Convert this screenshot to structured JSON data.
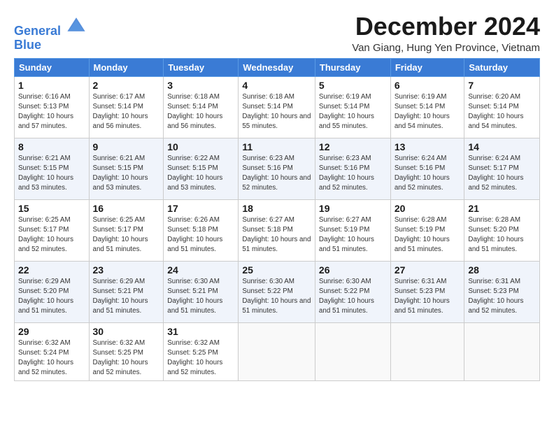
{
  "header": {
    "logo_line1": "General",
    "logo_line2": "Blue",
    "month_title": "December 2024",
    "subtitle": "Van Giang, Hung Yen Province, Vietnam"
  },
  "weekdays": [
    "Sunday",
    "Monday",
    "Tuesday",
    "Wednesday",
    "Thursday",
    "Friday",
    "Saturday"
  ],
  "weeks": [
    [
      {
        "day": 1,
        "sunrise": "6:16 AM",
        "sunset": "5:13 PM",
        "daylight": "10 hours and 57 minutes."
      },
      {
        "day": 2,
        "sunrise": "6:17 AM",
        "sunset": "5:14 PM",
        "daylight": "10 hours and 56 minutes."
      },
      {
        "day": 3,
        "sunrise": "6:18 AM",
        "sunset": "5:14 PM",
        "daylight": "10 hours and 56 minutes."
      },
      {
        "day": 4,
        "sunrise": "6:18 AM",
        "sunset": "5:14 PM",
        "daylight": "10 hours and 55 minutes."
      },
      {
        "day": 5,
        "sunrise": "6:19 AM",
        "sunset": "5:14 PM",
        "daylight": "10 hours and 55 minutes."
      },
      {
        "day": 6,
        "sunrise": "6:19 AM",
        "sunset": "5:14 PM",
        "daylight": "10 hours and 54 minutes."
      },
      {
        "day": 7,
        "sunrise": "6:20 AM",
        "sunset": "5:14 PM",
        "daylight": "10 hours and 54 minutes."
      }
    ],
    [
      {
        "day": 8,
        "sunrise": "6:21 AM",
        "sunset": "5:15 PM",
        "daylight": "10 hours and 53 minutes."
      },
      {
        "day": 9,
        "sunrise": "6:21 AM",
        "sunset": "5:15 PM",
        "daylight": "10 hours and 53 minutes."
      },
      {
        "day": 10,
        "sunrise": "6:22 AM",
        "sunset": "5:15 PM",
        "daylight": "10 hours and 53 minutes."
      },
      {
        "day": 11,
        "sunrise": "6:23 AM",
        "sunset": "5:16 PM",
        "daylight": "10 hours and 52 minutes."
      },
      {
        "day": 12,
        "sunrise": "6:23 AM",
        "sunset": "5:16 PM",
        "daylight": "10 hours and 52 minutes."
      },
      {
        "day": 13,
        "sunrise": "6:24 AM",
        "sunset": "5:16 PM",
        "daylight": "10 hours and 52 minutes."
      },
      {
        "day": 14,
        "sunrise": "6:24 AM",
        "sunset": "5:17 PM",
        "daylight": "10 hours and 52 minutes."
      }
    ],
    [
      {
        "day": 15,
        "sunrise": "6:25 AM",
        "sunset": "5:17 PM",
        "daylight": "10 hours and 52 minutes."
      },
      {
        "day": 16,
        "sunrise": "6:25 AM",
        "sunset": "5:17 PM",
        "daylight": "10 hours and 51 minutes."
      },
      {
        "day": 17,
        "sunrise": "6:26 AM",
        "sunset": "5:18 PM",
        "daylight": "10 hours and 51 minutes."
      },
      {
        "day": 18,
        "sunrise": "6:27 AM",
        "sunset": "5:18 PM",
        "daylight": "10 hours and 51 minutes."
      },
      {
        "day": 19,
        "sunrise": "6:27 AM",
        "sunset": "5:19 PM",
        "daylight": "10 hours and 51 minutes."
      },
      {
        "day": 20,
        "sunrise": "6:28 AM",
        "sunset": "5:19 PM",
        "daylight": "10 hours and 51 minutes."
      },
      {
        "day": 21,
        "sunrise": "6:28 AM",
        "sunset": "5:20 PM",
        "daylight": "10 hours and 51 minutes."
      }
    ],
    [
      {
        "day": 22,
        "sunrise": "6:29 AM",
        "sunset": "5:20 PM",
        "daylight": "10 hours and 51 minutes."
      },
      {
        "day": 23,
        "sunrise": "6:29 AM",
        "sunset": "5:21 PM",
        "daylight": "10 hours and 51 minutes."
      },
      {
        "day": 24,
        "sunrise": "6:30 AM",
        "sunset": "5:21 PM",
        "daylight": "10 hours and 51 minutes."
      },
      {
        "day": 25,
        "sunrise": "6:30 AM",
        "sunset": "5:22 PM",
        "daylight": "10 hours and 51 minutes."
      },
      {
        "day": 26,
        "sunrise": "6:30 AM",
        "sunset": "5:22 PM",
        "daylight": "10 hours and 51 minutes."
      },
      {
        "day": 27,
        "sunrise": "6:31 AM",
        "sunset": "5:23 PM",
        "daylight": "10 hours and 51 minutes."
      },
      {
        "day": 28,
        "sunrise": "6:31 AM",
        "sunset": "5:23 PM",
        "daylight": "10 hours and 52 minutes."
      }
    ],
    [
      {
        "day": 29,
        "sunrise": "6:32 AM",
        "sunset": "5:24 PM",
        "daylight": "10 hours and 52 minutes."
      },
      {
        "day": 30,
        "sunrise": "6:32 AM",
        "sunset": "5:25 PM",
        "daylight": "10 hours and 52 minutes."
      },
      {
        "day": 31,
        "sunrise": "6:32 AM",
        "sunset": "5:25 PM",
        "daylight": "10 hours and 52 minutes."
      },
      null,
      null,
      null,
      null
    ]
  ]
}
